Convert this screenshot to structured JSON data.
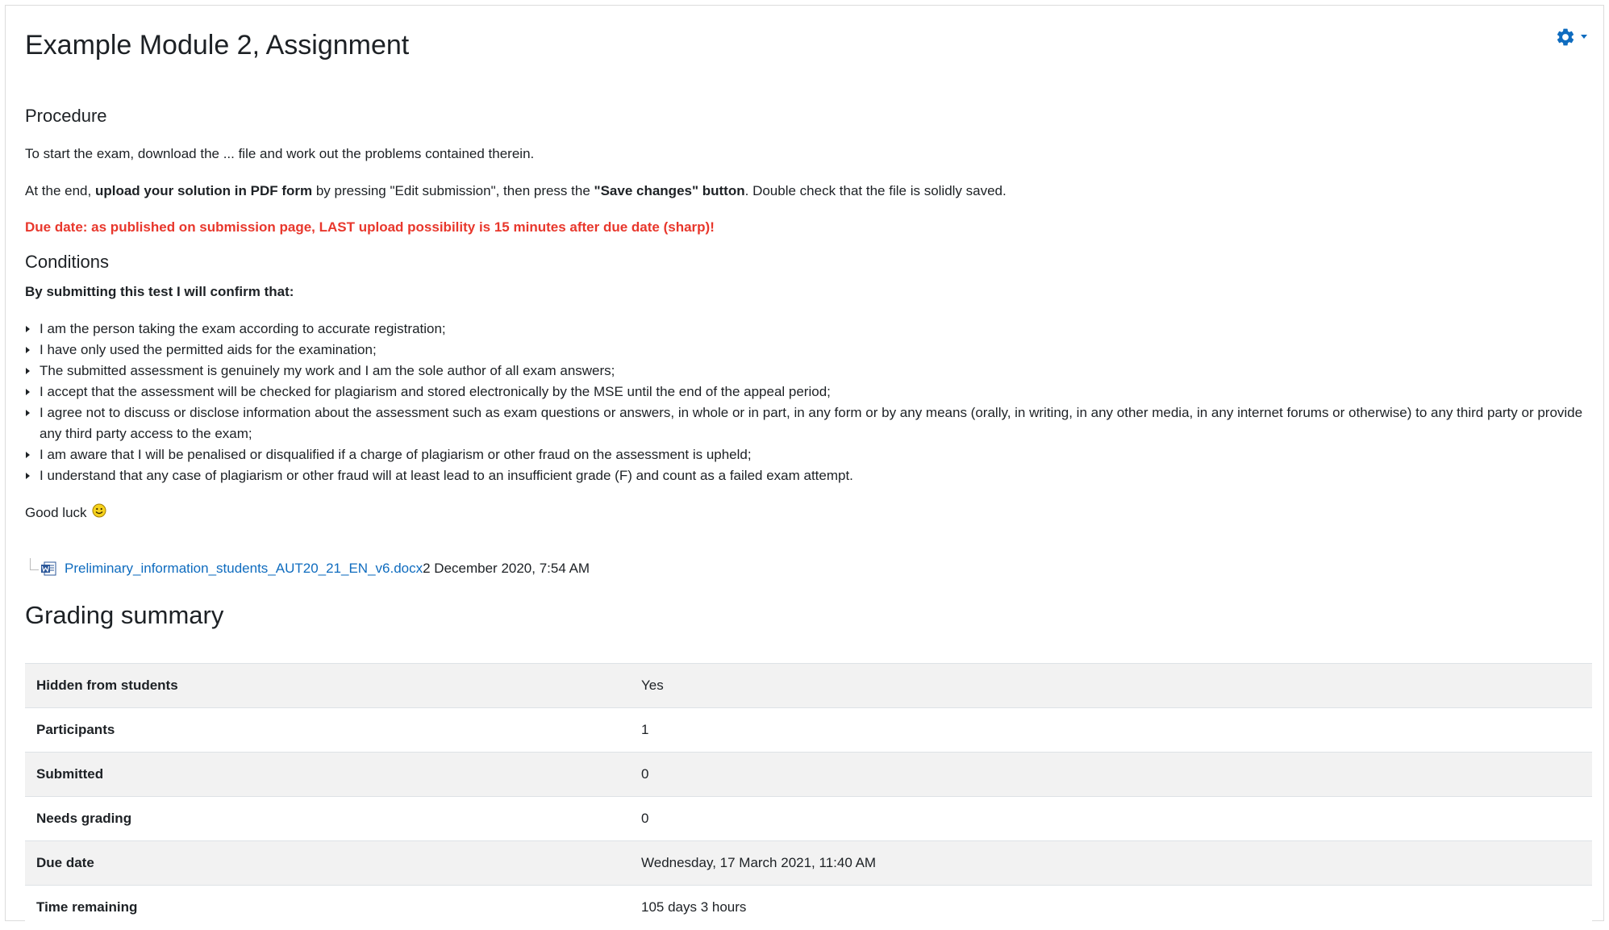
{
  "page": {
    "title": "Example Module 2, Assignment"
  },
  "procedure": {
    "heading": "Procedure",
    "intro": "To start the exam, download the ... file and work out the problems contained therein.",
    "upload_pre": "At the end, ",
    "upload_bold": "upload your solution in PDF form",
    "upload_mid": " by pressing \"Edit submission\", then press the ",
    "upload_bold2": "\"Save changes\" button",
    "upload_post": ". Double check that the file is solidly saved.",
    "due_warning": "Due date: as published on submission page, LAST upload possibility is 15 minutes after due date (sharp)!"
  },
  "conditions": {
    "heading": "Conditions",
    "confirm": "By submitting this test I will confirm that:",
    "items": [
      "I am the person taking the exam according to accurate registration;",
      "I have only used the permitted aids for the examination;",
      "The submitted assessment is genuinely my work and I am the sole author of all exam answers;",
      "I accept that the assessment will be checked for plagiarism and stored electronically by the MSE until the end of the appeal period;",
      "I agree not to discuss or disclose information about the assessment such as exam questions or answers, in whole or in part, in any form or by any means (orally, in writing, in any other media, in any internet forums or otherwise) to any third party or provide any third party access to the exam;",
      "I am aware that I will be penalised or disqualified if a charge of plagiarism or other fraud on the assessment is upheld;",
      "I understand that any case of plagiarism or other fraud will at least lead to an insufficient grade (F) and count as a failed exam attempt."
    ],
    "good_luck": "Good luck"
  },
  "attachment": {
    "file_name": "Preliminary_information_students_AUT20_21_EN_v6.docx",
    "date": "2 December 2020, 7:54 AM"
  },
  "grading": {
    "heading": "Grading summary",
    "rows": [
      {
        "label": "Hidden from students",
        "value": "Yes"
      },
      {
        "label": "Participants",
        "value": "1"
      },
      {
        "label": "Submitted",
        "value": "0"
      },
      {
        "label": "Needs grading",
        "value": "0"
      },
      {
        "label": "Due date",
        "value": "Wednesday, 17 March 2021, 11:40 AM"
      },
      {
        "label": "Time remaining",
        "value": "105 days 3 hours"
      }
    ]
  },
  "icons": {
    "settings": "gear-icon",
    "file": "word-document-icon",
    "emoji": "smiley-icon"
  },
  "colors": {
    "accent": "#0f6cbf",
    "warning": "#e8372c"
  }
}
